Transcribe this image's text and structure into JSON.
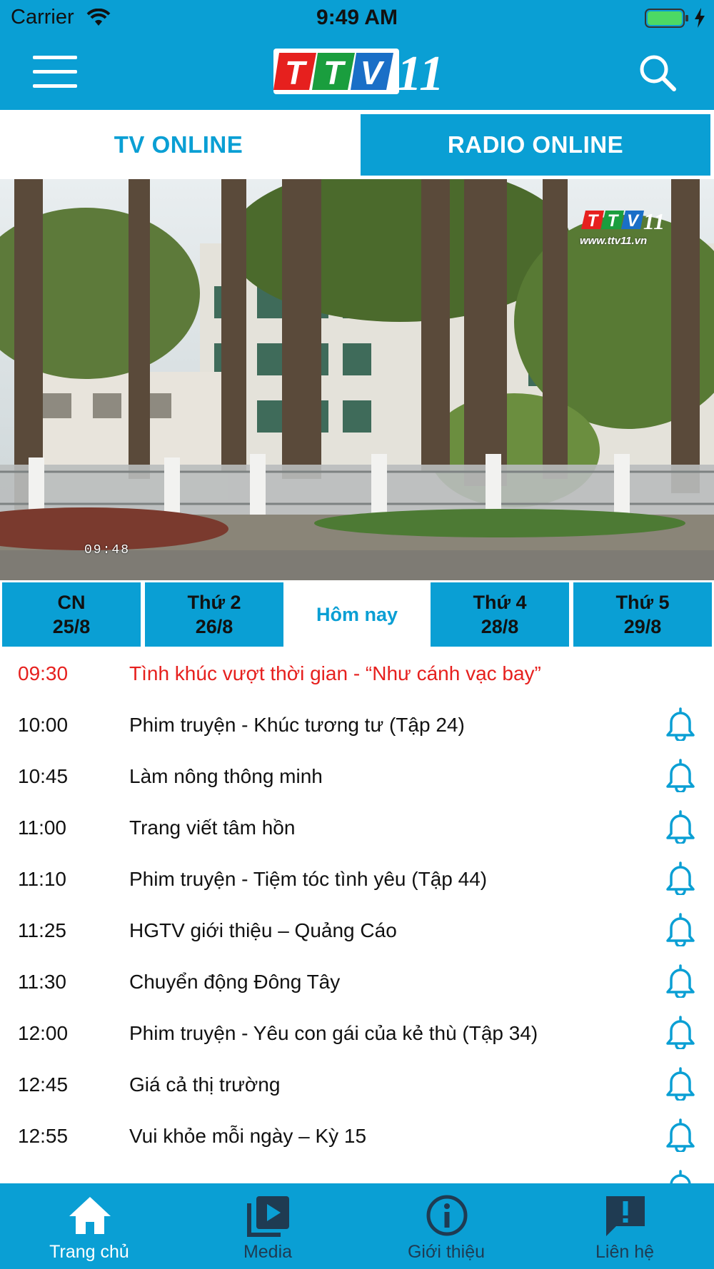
{
  "status_bar": {
    "carrier": "Carrier",
    "time": "9:49 AM"
  },
  "header": {
    "logo_text": "TTV11"
  },
  "tabs": [
    {
      "label": "TV ONLINE",
      "active": true
    },
    {
      "label": "RADIO ONLINE",
      "active": false
    }
  ],
  "video": {
    "timestamp": "09:48",
    "watermark_url": "www.ttv11.vn"
  },
  "days": [
    {
      "name": "CN",
      "date": "25/8"
    },
    {
      "name": "Thứ 2",
      "date": "26/8"
    },
    {
      "name": "Hôm nay",
      "date": "",
      "active": true
    },
    {
      "name": "Thứ 4",
      "date": "28/8"
    },
    {
      "name": "Thứ 5",
      "date": "29/8"
    }
  ],
  "schedule": [
    {
      "time": "09:30",
      "title": "Tình khúc vượt thời gian - “Như cánh vạc bay”",
      "current": true
    },
    {
      "time": "10:00",
      "title": "Phim truyện - Khúc tương tư (Tập 24)"
    },
    {
      "time": "10:45",
      "title": "Làm nông thông minh"
    },
    {
      "time": "11:00",
      "title": "Trang viết tâm hồn"
    },
    {
      "time": "11:10",
      "title": "Phim truyện - Tiệm tóc tình yêu (Tập 44)"
    },
    {
      "time": "11:25",
      "title": "HGTV giới thiệu – Quảng Cáo"
    },
    {
      "time": "11:30",
      "title": "Chuyển động Đông Tây"
    },
    {
      "time": "12:00",
      "title": "Phim truyện - Yêu con gái của kẻ thù (Tập 34)"
    },
    {
      "time": "12:45",
      "title": "Giá cả thị trường"
    },
    {
      "time": "12:55",
      "title": "Vui khỏe mỗi ngày – Kỳ 15"
    }
  ],
  "bottom_nav": [
    {
      "label": "Trang chủ",
      "icon": "home-icon",
      "active": true
    },
    {
      "label": "Media",
      "icon": "media-play-icon"
    },
    {
      "label": "Giới thiệu",
      "icon": "info-icon"
    },
    {
      "label": "Liên hệ",
      "icon": "contact-alert-icon"
    }
  ],
  "colors": {
    "brand_blue": "#0a9fd4",
    "current_red": "#e6201e",
    "nav_inactive": "#1f3b52"
  }
}
